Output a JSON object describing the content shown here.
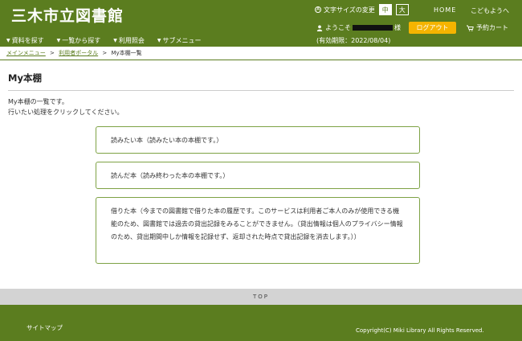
{
  "header": {
    "site_title": "三木市立図書館",
    "font_size_label": "文字サイズの変更",
    "font_size_mid": "中",
    "font_size_big": "大",
    "home": "HOME",
    "kids": "こどもようへ",
    "welcome_prefix": "ようこそ",
    "welcome_suffix": "様",
    "logout": "ログアウト",
    "cart": "予約カート",
    "expiry": "(有効期限：2022/08/04)",
    "brand_color": "#5b7d1f",
    "logout_color": "#f5b400"
  },
  "nav": {
    "items": [
      {
        "label": "資料を探す"
      },
      {
        "label": "一覧から探す"
      },
      {
        "label": "利用照会"
      },
      {
        "label": "サブメニュー"
      }
    ]
  },
  "breadcrumb": {
    "items": [
      "メインメニュー",
      "利用者ポータル",
      "My本棚一覧"
    ],
    "separator": ">"
  },
  "main": {
    "title": "My本棚",
    "desc_line1": "My本棚の一覧です。",
    "desc_line2": "行いたい処理をクリックしてください。",
    "shelves": [
      {
        "text": "読みたい本（読みたい本の本棚です。）"
      },
      {
        "text": "読んだ本（読み終わった本の本棚です。）"
      },
      {
        "text": "借りた本（今までの図書館で借りた本の履歴です。このサービスは利用者ご本人のみが使用できる機能のため、図書館では過去の貸出記録をみることができません。（貸出情報は個人のプライバシー情報のため、貸出期間中しか情報を記録せず、返却された時点で貸出記録を消去します。））"
      }
    ]
  },
  "top_link": "TOP",
  "footer": {
    "sitemap": "サイトマップ",
    "copyright": "Copyright(C) Miki Library All Rights Reserved."
  }
}
